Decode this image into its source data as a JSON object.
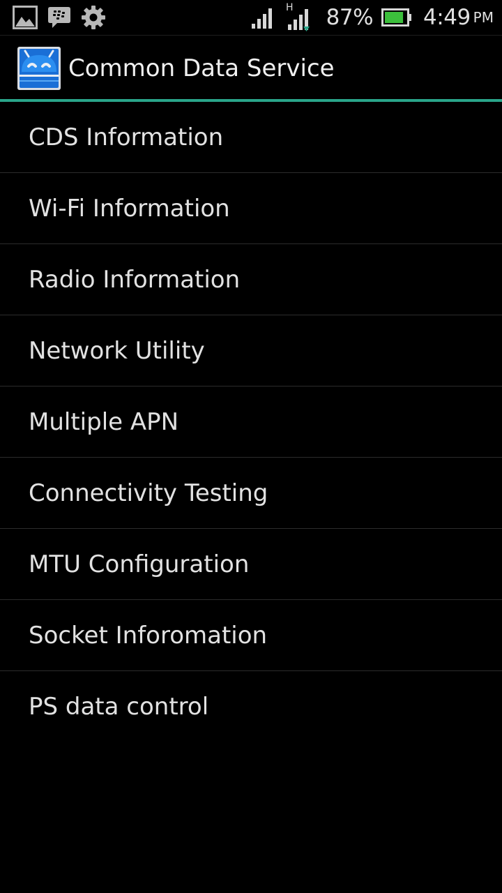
{
  "status_bar": {
    "notification_icons": [
      "gallery-icon",
      "bbm-chat-icon",
      "settings-gear-icon"
    ],
    "network_type": "H",
    "battery_percent": "87%",
    "battery_level": 0.87,
    "time": "4:49",
    "am_pm": "PM"
  },
  "action_bar": {
    "title": "Common Data Service",
    "accent_color": "#2aa58a"
  },
  "menu": {
    "items": [
      {
        "label": "CDS Information"
      },
      {
        "label": "Wi-Fi Information"
      },
      {
        "label": "Radio Information"
      },
      {
        "label": "Network Utility"
      },
      {
        "label": "Multiple APN"
      },
      {
        "label": "Connectivity Testing"
      },
      {
        "label": "MTU Configuration"
      },
      {
        "label": "Socket Inforomation"
      },
      {
        "label": "PS data control"
      }
    ]
  }
}
